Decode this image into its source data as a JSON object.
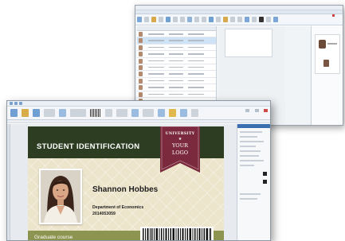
{
  "card": {
    "header_title": "STUDENT IDENTIFICATION",
    "badge_top": "UNIVERSITY",
    "badge_star": "★",
    "badge_line1": "YOUR",
    "badge_line2": "LOGO",
    "name": "Shannon Hobbes",
    "department": "Department of Economics",
    "id_number": "2014053059",
    "footer": "Graduate course"
  },
  "colors": {
    "header_band": "#2d3d21",
    "card_bg": "#ece4cb",
    "footer_band": "#8d9450",
    "badge": "#7a2a3c"
  },
  "icons": [
    "save-icon",
    "undo-icon",
    "print-icon",
    "barcode-icon",
    "close-icon"
  ]
}
